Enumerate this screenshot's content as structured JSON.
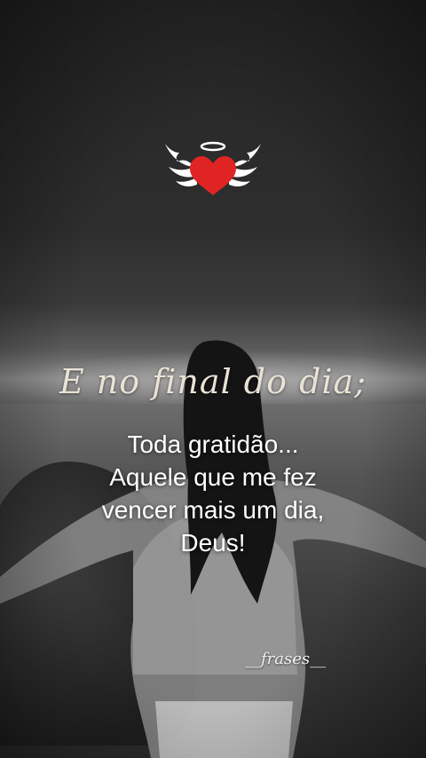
{
  "logo": {
    "icon": "angel-heart-icon",
    "heart_color": "#e02424",
    "wing_color": "#ffffff"
  },
  "headline": "E no final do dia;",
  "message": {
    "lines": [
      "Toda gratidão...",
      "Aquele que me fez",
      "vencer mais um dia,",
      "Deus!"
    ]
  },
  "signature": "__frases__",
  "colors": {
    "headline": "#e9e3d6",
    "text": "#ffffff"
  }
}
